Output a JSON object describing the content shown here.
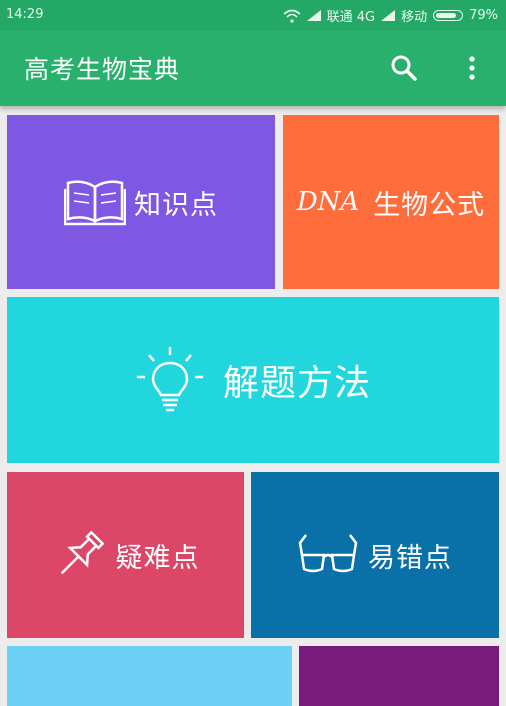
{
  "status_bar": {
    "time": "14:29",
    "carrier1": "联通 4G",
    "carrier2": "移动",
    "battery": "79%"
  },
  "app_bar": {
    "title": "高考生物宝典",
    "search_icon": "search-icon",
    "menu_icon": "more-vert-icon"
  },
  "tiles": [
    {
      "label": "知识点",
      "icon": "book-icon",
      "color": "#7e57e2"
    },
    {
      "prefix": "DNA",
      "label": "生物公式",
      "color": "#ff6d3c"
    },
    {
      "label": "解题方法",
      "icon": "lightbulb-icon",
      "color": "#22d6de"
    },
    {
      "label": "疑难点",
      "icon": "pushpin-icon",
      "color": "#dc4767"
    },
    {
      "label": "易错点",
      "icon": "glasses-icon",
      "color": "#0a71a8"
    },
    {
      "label": "",
      "color": "#6cd1f5"
    },
    {
      "label": "",
      "color": "#7a1b7b"
    }
  ],
  "colors": {
    "status_bar": "#24a865",
    "app_bar": "#29b06d",
    "background": "#ececec"
  }
}
